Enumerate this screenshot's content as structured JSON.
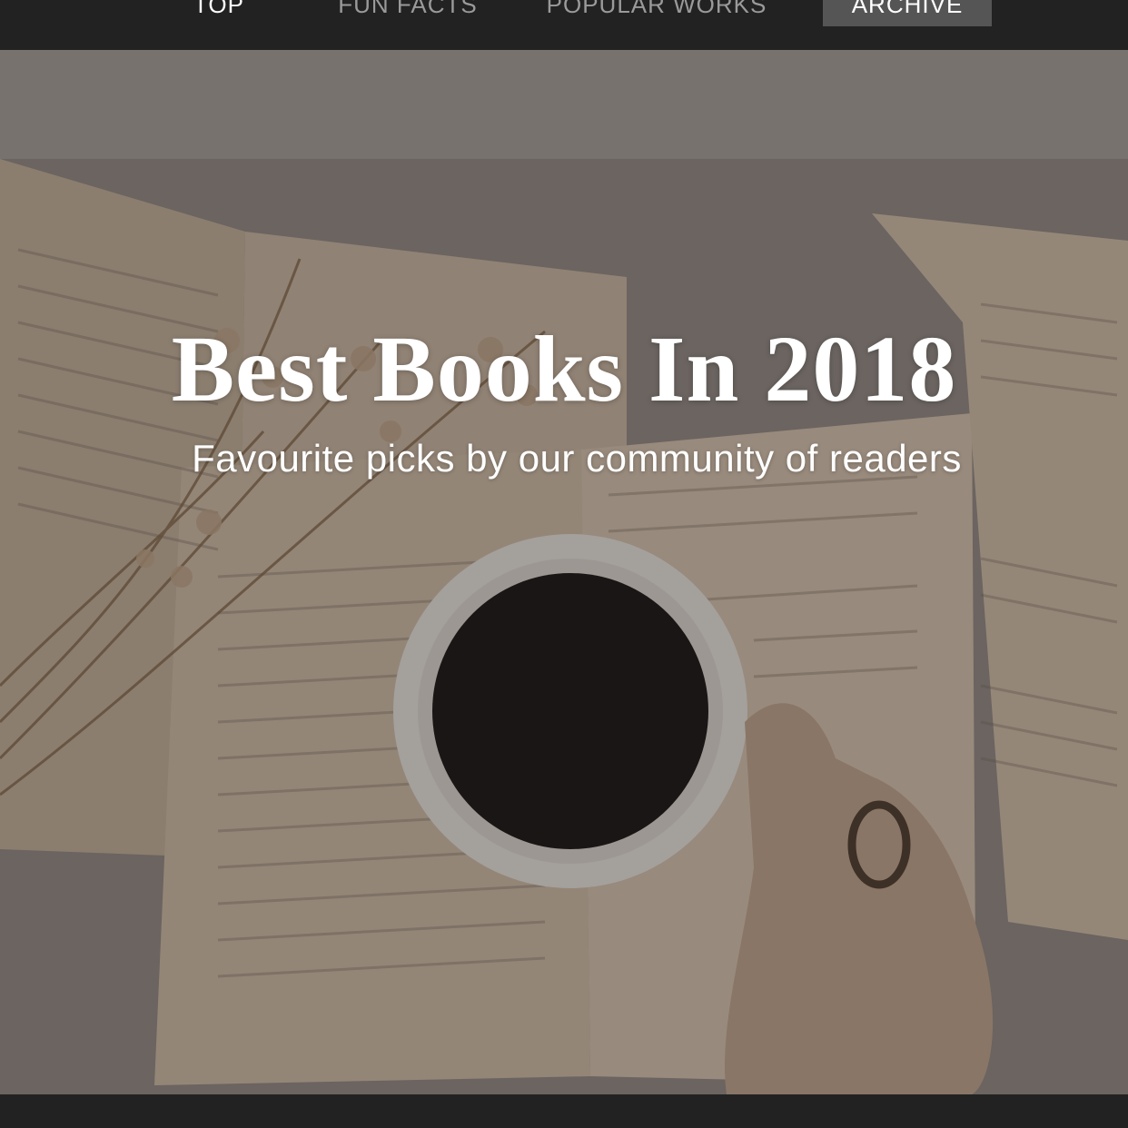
{
  "nav": {
    "items": [
      {
        "label": "TOP",
        "active": false
      },
      {
        "label": "FUN FACTS",
        "active": false
      },
      {
        "label": "POPULAR WORKS",
        "active": false
      },
      {
        "label": "ARCHIVE",
        "active": true
      }
    ]
  },
  "hero": {
    "title": "Best Books In 2018",
    "subtitle": "Favourite picks by our community of readers",
    "image_subject": "open books with a cup of black coffee held by a hand and dried flowers"
  },
  "colors": {
    "nav_background": "#222222",
    "nav_active_background": "#555555",
    "nav_text": "#9a9a9a",
    "nav_active_text": "#ffffff",
    "hero_text": "#ffffff"
  }
}
